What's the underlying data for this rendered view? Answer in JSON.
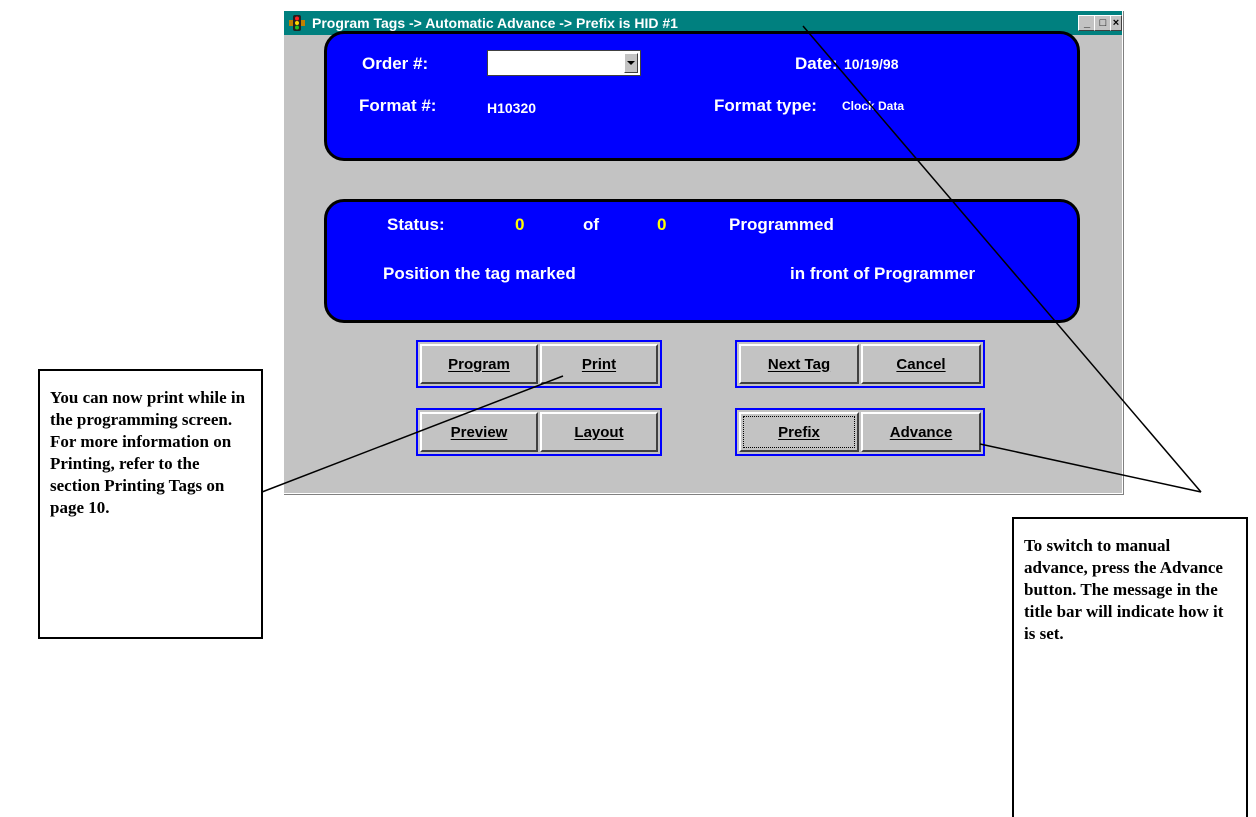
{
  "window": {
    "title": "Program Tags -> Automatic Advance -> Prefix is HID #1",
    "controls": {
      "minimize": "_",
      "maximize": "□",
      "close": "×"
    }
  },
  "info_panel": {
    "order_label": "Order #:",
    "order_value": "",
    "format_label": "Format #:",
    "format_value": "H10320",
    "date_label": "Date:",
    "date_value": "10/19/98",
    "format_type_label": "Format type:",
    "format_type_value": "Clock Data"
  },
  "status_panel": {
    "status_label": "Status:",
    "count_done": "0",
    "of_label": "of",
    "count_total": "0",
    "programmed_label": "Programmed",
    "position_text": "Position the tag marked",
    "front_text": "in front of Programmer",
    "count_color": "#ffff00"
  },
  "buttons": {
    "program": "Program",
    "print": "Print",
    "next_tag": "Next Tag",
    "cancel": "Cancel",
    "preview": "Preview",
    "layout": "Layout",
    "prefix": "Prefix",
    "advance": "Advance"
  },
  "callouts": {
    "print_note": "You can now print while in the programming screen.  For more information on Printing, refer to the section Printing Tags on page 10.",
    "advance_note": "To switch to manual advance, press the Advance button.  The message in the title bar will indicate how it is set."
  },
  "colors": {
    "title_bar": "#00807f",
    "panel_blue": "#0000ff",
    "window_gray": "#c3c3c3"
  }
}
